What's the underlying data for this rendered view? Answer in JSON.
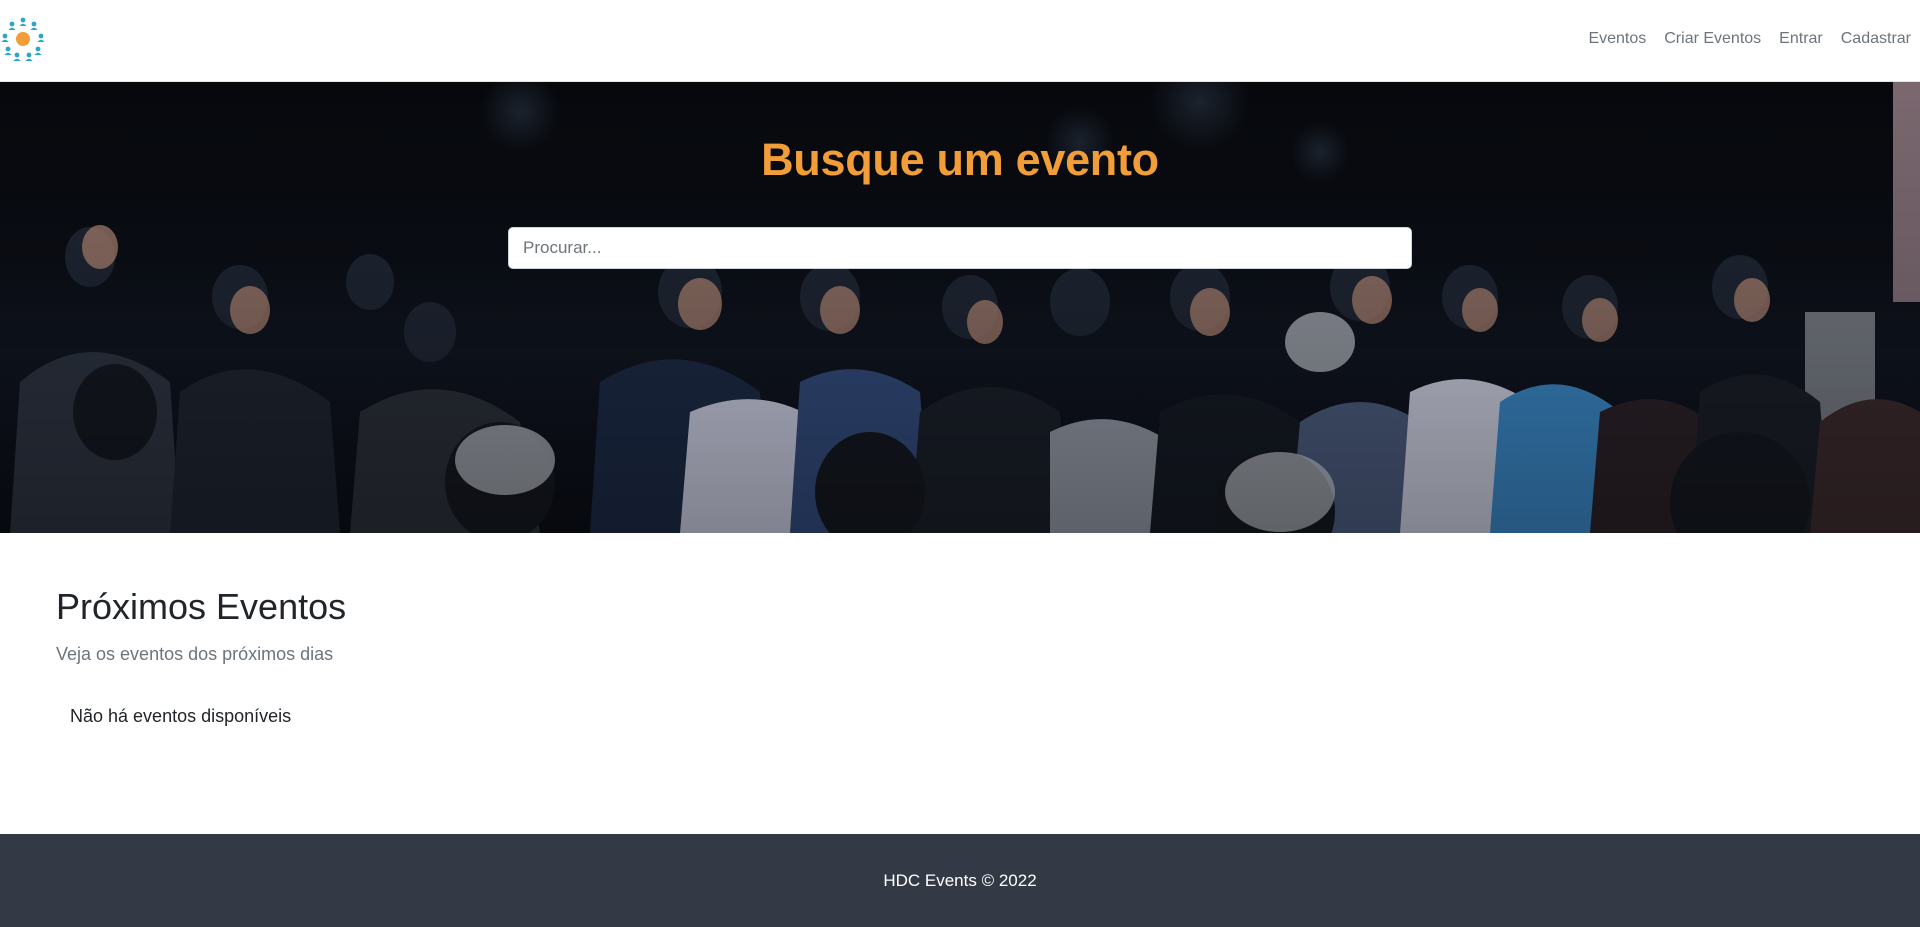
{
  "navbar": {
    "logo_icon": "people-network-logo-icon",
    "links": [
      "Eventos",
      "Criar Eventos",
      "Entrar",
      "Cadastrar"
    ]
  },
  "hero": {
    "title": "Busque um evento",
    "search_placeholder": "Procurar...",
    "search_value": ""
  },
  "events_section": {
    "title": "Próximos Eventos",
    "subtitle": "Veja os eventos dos próximos dias",
    "empty_message": "Não há eventos disponíveis"
  },
  "footer": {
    "text": "HDC Events © 2022"
  },
  "colors": {
    "accent": "#f19d38",
    "logo_blue": "#2aa6c8",
    "footer_bg": "#343a45",
    "nav_link": "#6c757d"
  }
}
